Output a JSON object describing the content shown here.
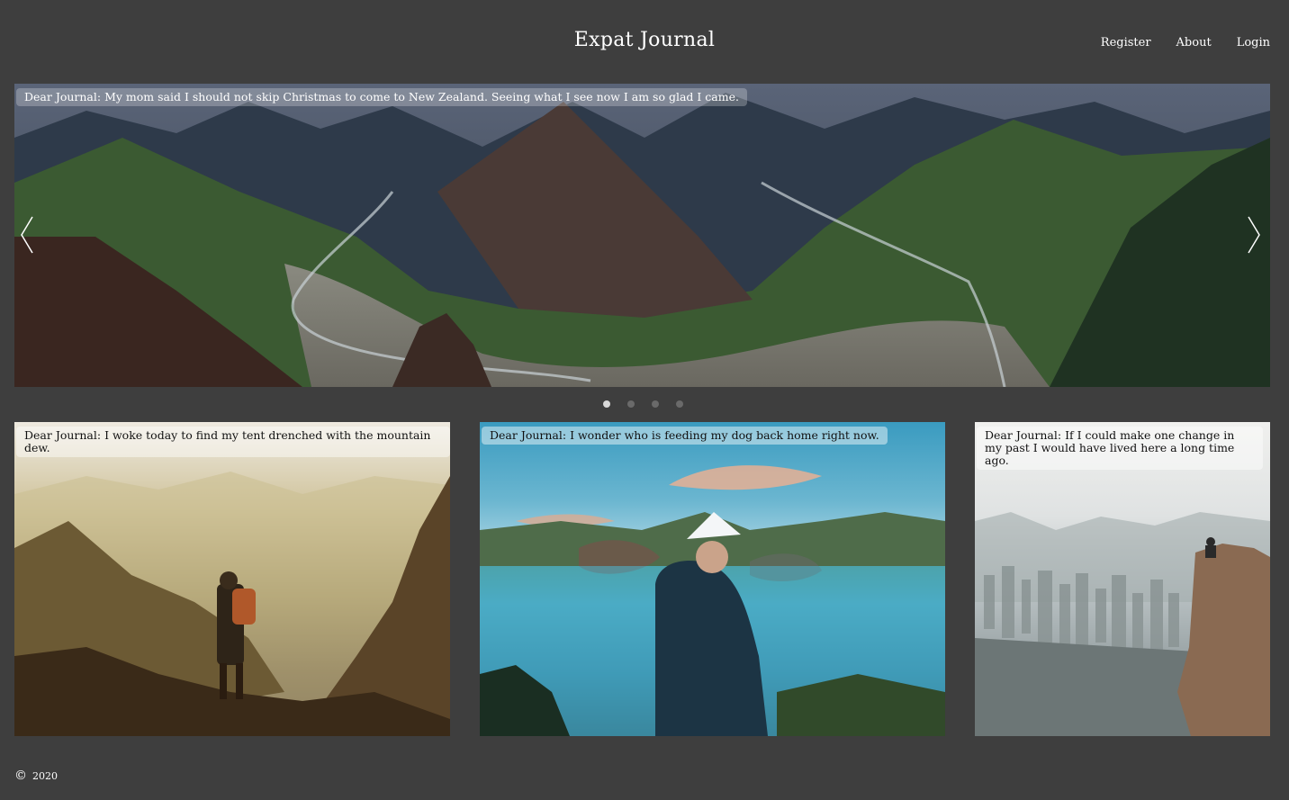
{
  "header": {
    "title": "Expat Journal",
    "nav": [
      "Register",
      "About",
      "Login"
    ]
  },
  "carousel": {
    "caption": "Dear Journal: My mom said I should not skip Christmas to come to New Zealand. Seeing what I see now I am so glad I came.",
    "slide_count": 4,
    "active_index": 0
  },
  "cards": [
    {
      "caption": "Dear Journal: I woke today to find my tent drenched with the mountain dew."
    },
    {
      "caption": "Dear Journal: I wonder who is feeding my dog back home right now."
    },
    {
      "caption": "Dear Journal: If I could make one change in my past I would have lived here a long time ago."
    }
  ],
  "footer": {
    "copyright_symbol": "©",
    "year": "2020"
  }
}
